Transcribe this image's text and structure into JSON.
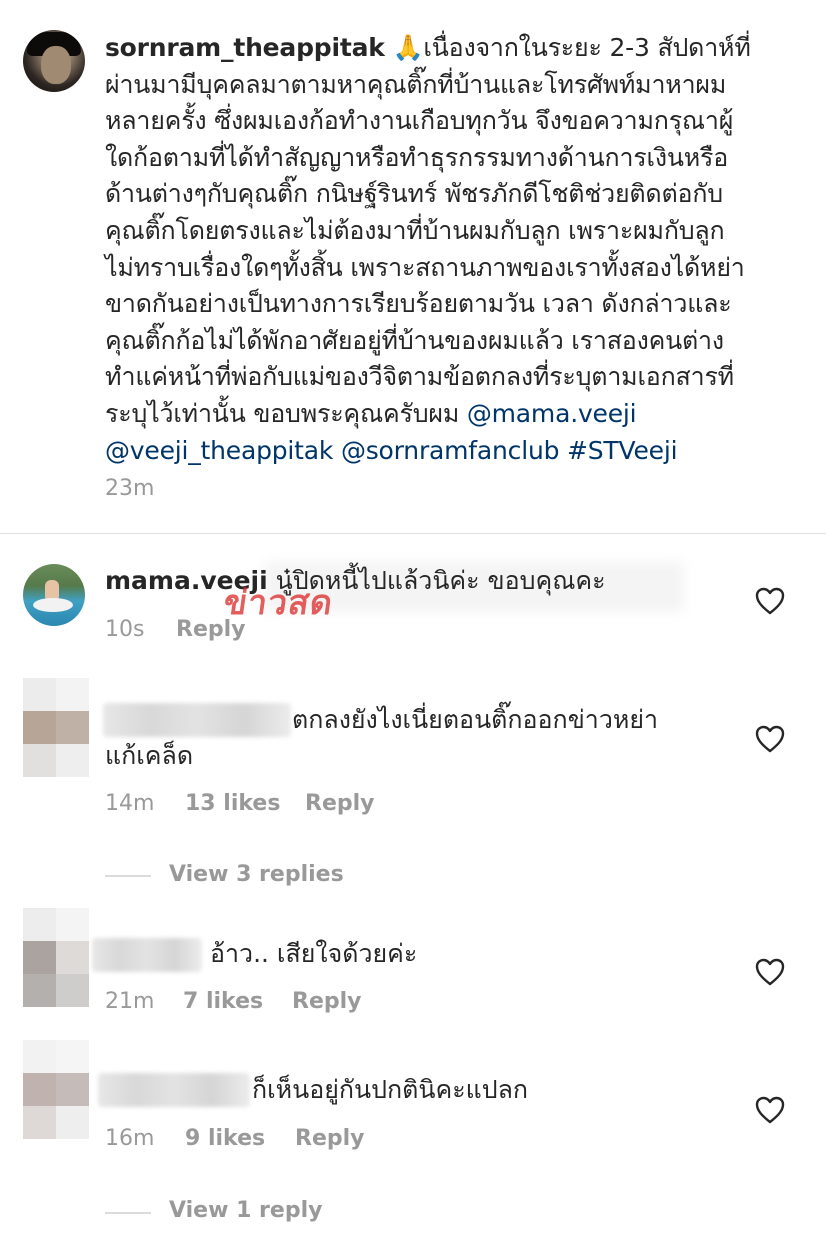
{
  "post": {
    "username": "sornram_theappitak",
    "emoji": "🙏",
    "caption_lines": [
      "เนื่องจากในระยะ 2-3 สัปดาห์ที่",
      "ผ่านมามีบุคคลมาตามหาคุณติ๊กที่บ้านและโทรศัพท์มาหาผม",
      "หลายครั้ง ซึ่งผมเองก้อทำงานเกือบทุกวัน จึงขอความกรุณาผู้",
      "ใดก้อตามที่ได้ทำสัญญาหรือทำธุรกรรมทางด้านการเงินหรือ",
      "ด้านต่างๆกับคุณติ๊ก กนิษฐ์รินทร์ พัชรภักดีโชติช่วยติดต่อกับ",
      "คุณติ๊กโดยตรงและไม่ต้องมาที่บ้านผมกับลูก เพราะผมกับลูก",
      "ไม่ทราบเรื่องใดๆทั้งสิ้น เพราะสถานภาพของเราทั้งสองได้หย่า",
      "ขาดกันอย่างเป็นทางการเรียบร้อยตามวัน เวลา ดังกล่าวและ",
      "คุณติ๊กก้อไม่ได้พักอาศัยอยู่ที่บ้านของผมแล้ว เราสองคนต่าง",
      "ทำแค่หน้าที่พ่อกับแม่ของวีจิตามข้อตกลงที่ระบุตามเอกสารที่",
      "ระบุไว้เท่านั้น ขอบพระคุณครับผม"
    ],
    "mentions": [
      "@mama.veeji",
      "@veeji_theappitak",
      "@sornramfanclub",
      "#STVeeji"
    ],
    "time": "23m"
  },
  "comments": [
    {
      "username": "mama.veeji",
      "text": "นู๋ปิดหนี้ไปแล้วนิค่ะ ขอบคุณคะ",
      "time": "10s",
      "likes": "",
      "reply_label": "Reply"
    },
    {
      "username": "",
      "text_line1": "ตกลงยังไงเนี่ยตอนติ๊กออกข่าวหย่า",
      "text_line2": "แก้เคล็ด",
      "time": "14m",
      "likes": "13 likes",
      "reply_label": "Reply",
      "view_replies": "View 3 replies"
    },
    {
      "username": "",
      "text": "อ้าว.. เสียใจด้วยค่ะ",
      "time": "21m",
      "likes": "7 likes",
      "reply_label": "Reply"
    },
    {
      "username": "",
      "text": "ก็เห็นอยู่กันปกตินิคะแปลก",
      "time": "16m",
      "likes": "9 likes",
      "reply_label": "Reply",
      "view_replies": "View 1 reply"
    }
  ],
  "watermark": "ข่าวสด",
  "icons": {
    "heart": "heart-outline-icon",
    "pray": "folded-hands-emoji"
  },
  "colors": {
    "text": "#262626",
    "meta": "#999999",
    "mention": "#003569",
    "divider": "#e0e0e0"
  }
}
